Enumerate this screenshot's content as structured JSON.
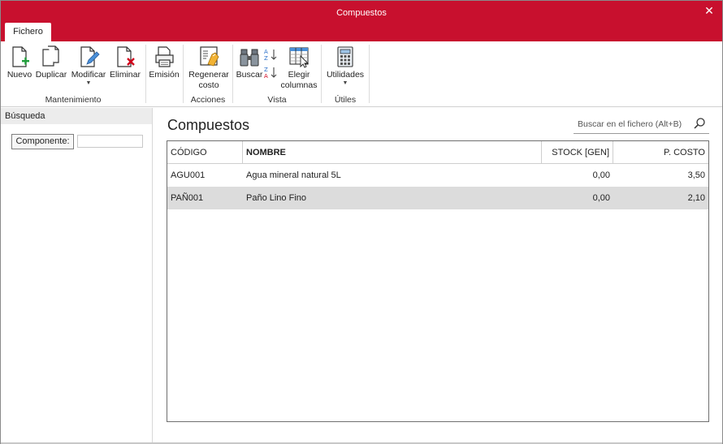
{
  "window": {
    "title": "Compuestos"
  },
  "ribbon": {
    "tabs": [
      {
        "label": "Fichero"
      }
    ],
    "groups": {
      "mantenimiento": {
        "label": "Mantenimiento",
        "buttons": {
          "nuevo": "Nuevo",
          "duplicar": "Duplicar",
          "modificar": "Modificar",
          "eliminar": "Eliminar"
        }
      },
      "emision": {
        "label": "",
        "buttons": {
          "emision": "Emisión"
        }
      },
      "acciones": {
        "label": "Acciones",
        "buttons": {
          "regenerar_line1": "Regenerar",
          "regenerar_line2": "costo"
        }
      },
      "vista": {
        "label": "Vista",
        "buttons": {
          "buscar": "Buscar",
          "elegir_line1": "Elegir",
          "elegir_line2": "columnas"
        }
      },
      "utiles": {
        "label": "Útiles",
        "buttons": {
          "utilidades": "Utilidades"
        }
      }
    }
  },
  "left_panel": {
    "header": "Búsqueda",
    "component_button": "Componente:",
    "component_input": {
      "value": "",
      "placeholder": ""
    }
  },
  "main": {
    "heading": "Compuestos",
    "search": {
      "placeholder": "Buscar en el fichero (Alt+B)",
      "value": ""
    },
    "table": {
      "columns": [
        "CÓDIGO",
        "NOMBRE",
        "STOCK [GEN]",
        "P. COSTO"
      ],
      "rows": [
        {
          "codigo": "AGU001",
          "nombre": "Agua mineral natural 5L",
          "stock": "0,00",
          "costo": "3,50",
          "selected": false
        },
        {
          "codigo": "PAÑ001",
          "nombre": "Paño Lino Fino",
          "stock": "0,00",
          "costo": "2,10",
          "selected": true
        }
      ]
    }
  },
  "colors": {
    "accent": "#c8102e",
    "selected_row": "#dcdcdc"
  },
  "icons": [
    "close-icon",
    "new-document-icon",
    "duplicate-icon",
    "edit-document-icon",
    "delete-document-icon",
    "printer-icon",
    "regenerate-cost-icon",
    "binoculars-icon",
    "sort-az-icon",
    "sort-za-icon",
    "choose-columns-icon",
    "calculator-icon",
    "search-icon"
  ]
}
